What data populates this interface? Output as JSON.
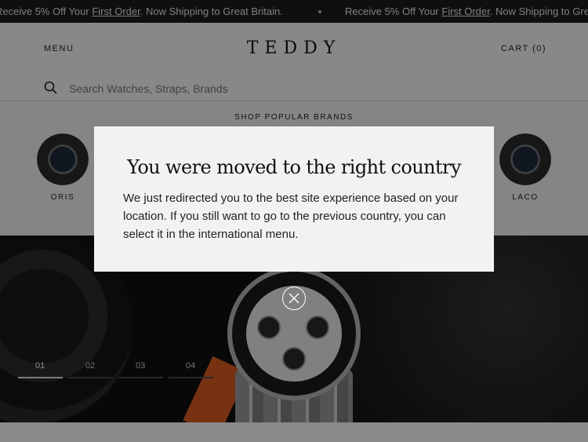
{
  "announcement": {
    "prefix": "Receive 5% Off Your ",
    "link": "First Order",
    "suffix": ". Now Shipping to Great Britain."
  },
  "header": {
    "menu_label": "MENU",
    "logo": "TEDDY",
    "cart_label": "CART (0)"
  },
  "search": {
    "placeholder": "Search Watches, Straps, Brands",
    "icon": "search-icon"
  },
  "brands": {
    "title": "SHOP POPULAR BRANDS",
    "items": [
      {
        "label": "ORIS"
      },
      {
        "label": "LACO"
      }
    ]
  },
  "hero": {
    "slides": [
      "01",
      "02",
      "03",
      "04"
    ],
    "active_slide": 0
  },
  "modal": {
    "title": "You were moved to the right country",
    "body": "We just redirected you to the best site experience based on your location. If you still want to go to the previous country, you can select it in the international menu.",
    "close_icon": "close-icon"
  },
  "colors": {
    "announcement_bg": "#1c1c1c",
    "accent_strap": "#d85b1f",
    "modal_bg": "#f2f2f2"
  }
}
